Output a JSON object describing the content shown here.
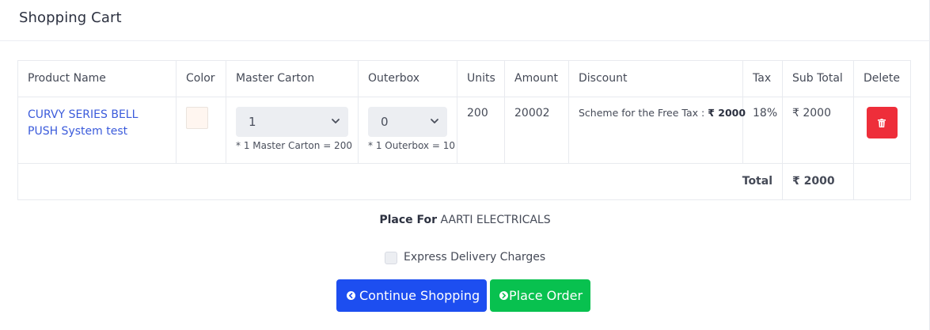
{
  "header": {
    "title": "Shopping Cart"
  },
  "table": {
    "columns": [
      "Product Name",
      "Color",
      "Master Carton",
      "Outerbox",
      "Units",
      "Amount",
      "Discount",
      "Tax",
      "Sub Total",
      "Delete"
    ],
    "item": {
      "product_name": "CURVY SERIES BELL PUSH System test",
      "color_swatch": "#fff6f0",
      "master_carton_value": "1",
      "master_carton_hint": "* 1 Master Carton = 200",
      "outerbox_value": "0",
      "outerbox_hint": "* 1 Outerbox = 10",
      "units": "200",
      "amount": "20002",
      "discount_label": "Scheme for the Free Tax :",
      "discount_value": "₹ 2000",
      "tax": "18%",
      "sub_total": "₹ 2000",
      "delete_icon": "trash-icon"
    },
    "total_label": "Total",
    "total_value": "₹ 2000"
  },
  "place_for": {
    "label": "Place For",
    "value": "AARTI ELECTRICALS"
  },
  "express_delivery": {
    "label": "Express Delivery Charges",
    "checked": false
  },
  "buttons": {
    "continue_shopping": "Continue Shopping",
    "place_order": "Place Order"
  },
  "colors": {
    "primary": "#1d4ef0",
    "success": "#08c14f",
    "danger": "#ee2e3a",
    "link": "#3b5bdb"
  }
}
